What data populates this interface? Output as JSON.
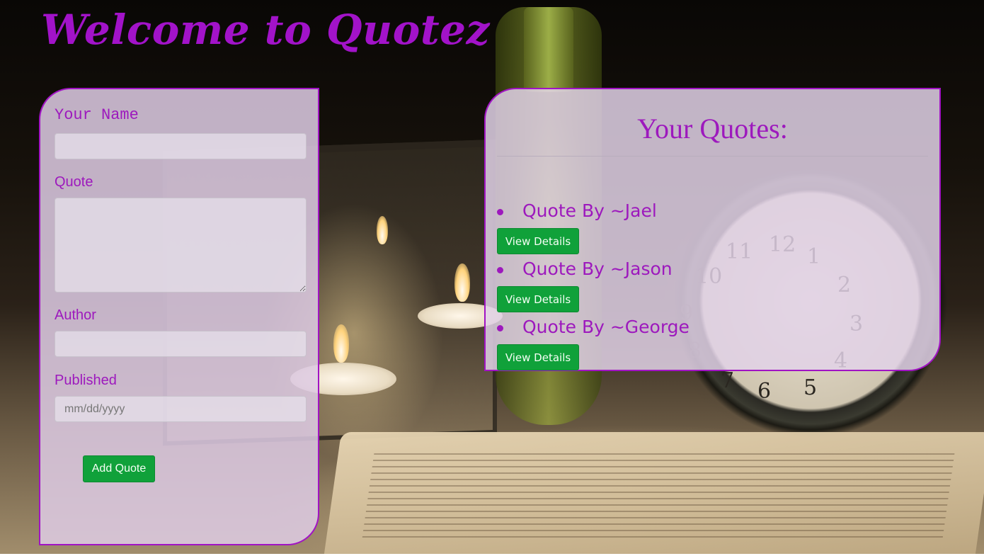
{
  "header": {
    "title": "Welcome to Quotez"
  },
  "form": {
    "name_label": "Your Name",
    "name_value": "",
    "quote_label": "Quote",
    "quote_value": "",
    "author_label": "Author",
    "author_value": "",
    "published_label": "Published",
    "published_placeholder": "mm/dd/yyyy",
    "submit_label": "Add Quote"
  },
  "quotes_panel": {
    "heading": "Your Quotes:",
    "items": [
      {
        "title": "Quote By ~Jael",
        "button_label": "View Details"
      },
      {
        "title": "Quote By ~Jason",
        "button_label": "View Details"
      },
      {
        "title": "Quote By ~George",
        "button_label": "View Details"
      }
    ]
  },
  "colors": {
    "accent_purple": "#a213c9",
    "button_green": "#10a13a",
    "panel_fill": "#e2d2e8"
  }
}
